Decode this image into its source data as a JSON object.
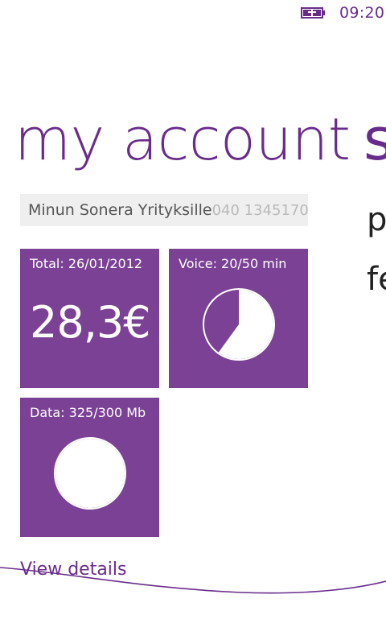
{
  "status": {
    "time": "09:20",
    "battery_icon": "battery-charging-icon"
  },
  "page": {
    "title": "my account",
    "next_title": "s",
    "peek_lines": [
      "p",
      "fe"
    ]
  },
  "account": {
    "name": "Minun Sonera Yrityksille",
    "number": "040 1345170"
  },
  "tiles": {
    "total": {
      "label": "Total: 26/01/2012",
      "amount": "28,3€"
    },
    "voice": {
      "label": "Voice: 20/50 min",
      "used": 20,
      "limit": 50
    },
    "data": {
      "label": "Data: 325/300 Mb",
      "used": 325,
      "limit": 300
    }
  },
  "footer": {
    "view_details": "View details"
  },
  "colors": {
    "accent": "#6a2c8c",
    "tile": "#7b4195",
    "account_bar": "#efefef"
  }
}
